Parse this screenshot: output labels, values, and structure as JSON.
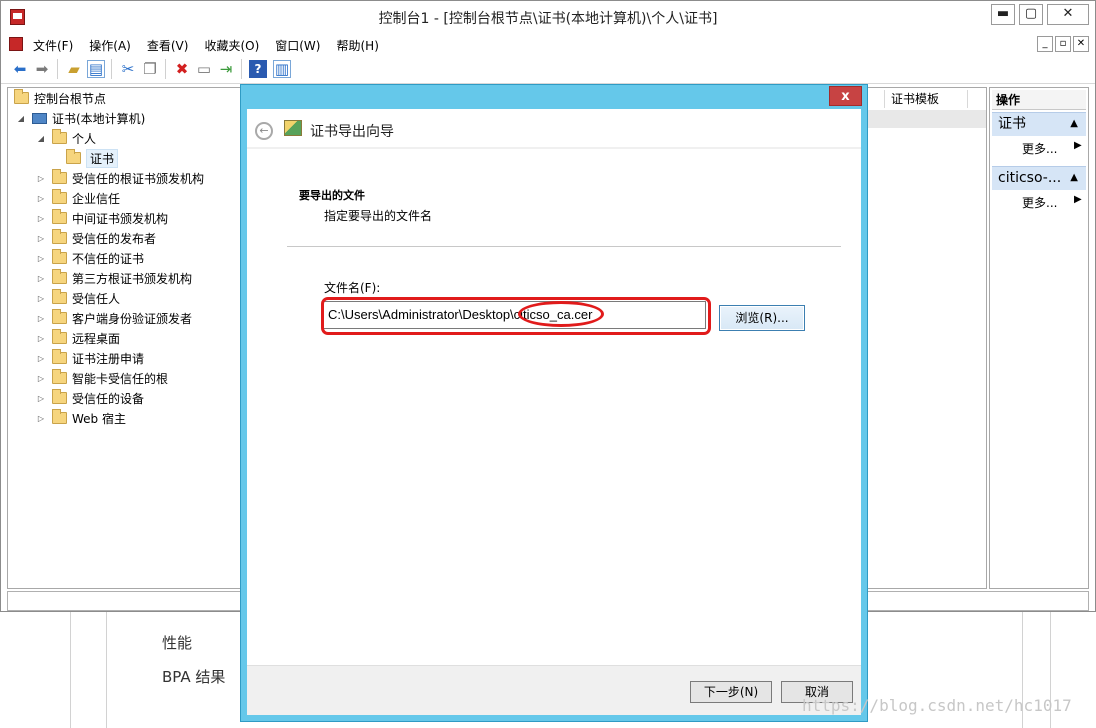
{
  "window": {
    "title": "控制台1 - [控制台根节点\\证书(本地计算机)\\个人\\证书]",
    "min": "▬",
    "max": "▢",
    "close": "✕"
  },
  "menu": [
    "文件(F)",
    "操作(A)",
    "查看(V)",
    "收藏夹(O)",
    "窗口(W)",
    "帮助(H)"
  ],
  "child_buttons": [
    "_",
    "▫",
    "✕"
  ],
  "toolbar_icons": [
    "back-icon",
    "forward-icon",
    "up-folder-icon",
    "show-tree-icon",
    "cut-icon",
    "copy-icon",
    "delete-icon",
    "properties-icon",
    "export-icon",
    "help-icon",
    "mmc-icon"
  ],
  "tree": {
    "root": "控制台根节点",
    "computer": "证书(本地计算机)",
    "personal": "个人",
    "certs": "证书",
    "items": [
      "受信任的根证书颁发机构",
      "企业信任",
      "中间证书颁发机构",
      "受信任的发布者",
      "不信任的证书",
      "第三方根证书颁发机构",
      "受信任人",
      "客户端身份验证颁发者",
      "远程桌面",
      "证书注册申请",
      "智能卡受信任的根",
      "受信任的设备",
      "Web 宿主"
    ]
  },
  "middle": {
    "column_header": "证书模板"
  },
  "actions": {
    "header": "操作",
    "section1": "证书",
    "section2": "citicso-...",
    "more": "更多..."
  },
  "background": {
    "label1": "性能",
    "label2": "BPA 结果",
    "watermark": "https://blog.csdn.net/hc1017"
  },
  "dialog": {
    "close": "x",
    "title": "证书导出向导",
    "section_title": "要导出的文件",
    "section_subtitle": "指定要导出的文件名",
    "filename_label": "文件名(F):",
    "filename_value": "C:\\Users\\Administrator\\Desktop\\citicso_ca.cer",
    "browse": "浏览(R)...",
    "next": "下一步(N)",
    "cancel": "取消"
  },
  "colors": {
    "dialog_frame": "#65c8ea",
    "highlight": "#e11b1b",
    "action_section": "#d6e5f6"
  }
}
